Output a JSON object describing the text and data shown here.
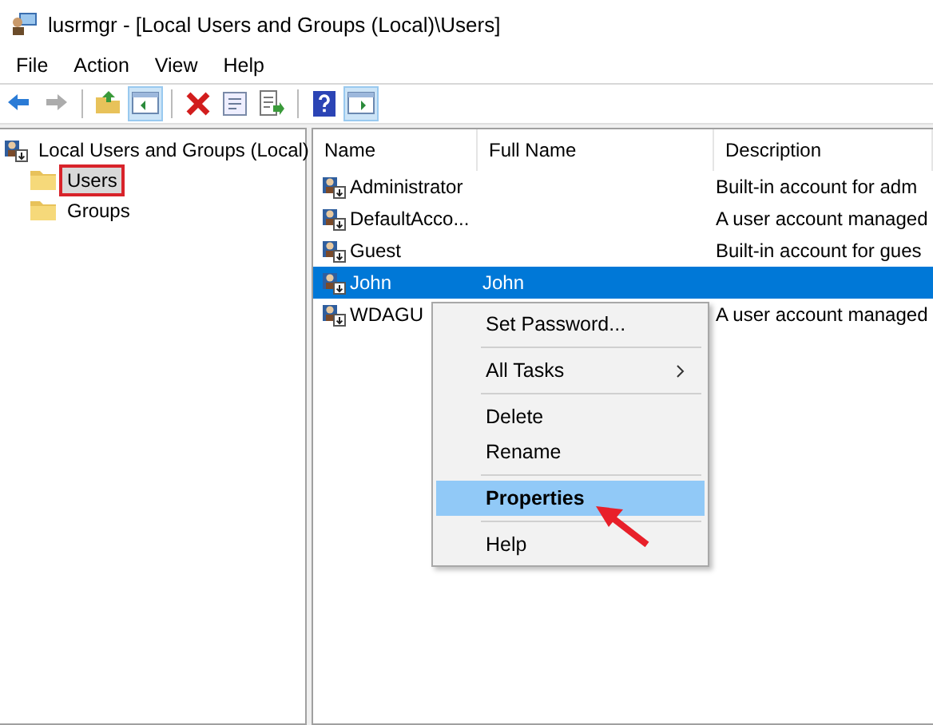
{
  "window": {
    "title": "lusrmgr - [Local Users and Groups (Local)\\Users]"
  },
  "menu_bar": [
    "File",
    "Action",
    "View",
    "Help"
  ],
  "toolbar": [
    {
      "kind": "back",
      "disabled": false
    },
    {
      "kind": "forward",
      "disabled": true
    },
    {
      "kind": "sep"
    },
    {
      "kind": "up",
      "disabled": false
    },
    {
      "kind": "tree",
      "disabled": false
    },
    {
      "kind": "sep"
    },
    {
      "kind": "delete",
      "disabled": false
    },
    {
      "kind": "properties",
      "disabled": false
    },
    {
      "kind": "export",
      "disabled": false
    },
    {
      "kind": "sep"
    },
    {
      "kind": "help",
      "disabled": false
    },
    {
      "kind": "pane",
      "disabled": false
    }
  ],
  "tree": {
    "label": "Local Users and Groups (Local)",
    "children": [
      {
        "label": "Users",
        "selected": true,
        "outlined": true
      },
      {
        "label": "Groups",
        "selected": false,
        "outlined": false
      }
    ]
  },
  "table": {
    "columns": [
      "Name",
      "Full Name",
      "Description"
    ],
    "rows": [
      {
        "name": "Administrator",
        "full_name": "",
        "description": "Built-in account for adm",
        "selected": false
      },
      {
        "name": "DefaultAcco...",
        "full_name": "",
        "description": "A user account managed",
        "selected": false
      },
      {
        "name": "Guest",
        "full_name": "",
        "description": "Built-in account for gues",
        "selected": false
      },
      {
        "name": "John",
        "full_name": "John",
        "description": "",
        "selected": true
      },
      {
        "name": "WDAGU",
        "full_name": "",
        "description": "A user account managed",
        "selected": false
      }
    ]
  },
  "context_menu": [
    {
      "kind": "item",
      "label": "Set Password...",
      "submenu": false,
      "selected": false,
      "arrow": false
    },
    {
      "kind": "sep"
    },
    {
      "kind": "item",
      "label": "All Tasks",
      "submenu": true,
      "selected": false,
      "arrow": false
    },
    {
      "kind": "sep"
    },
    {
      "kind": "item",
      "label": "Delete",
      "submenu": false,
      "selected": false,
      "arrow": false
    },
    {
      "kind": "item",
      "label": "Rename",
      "submenu": false,
      "selected": false,
      "arrow": false
    },
    {
      "kind": "sep"
    },
    {
      "kind": "item",
      "label": "Properties",
      "submenu": false,
      "selected": true,
      "arrow": true
    },
    {
      "kind": "sep"
    },
    {
      "kind": "item",
      "label": "Help",
      "submenu": false,
      "selected": false,
      "arrow": false
    }
  ]
}
